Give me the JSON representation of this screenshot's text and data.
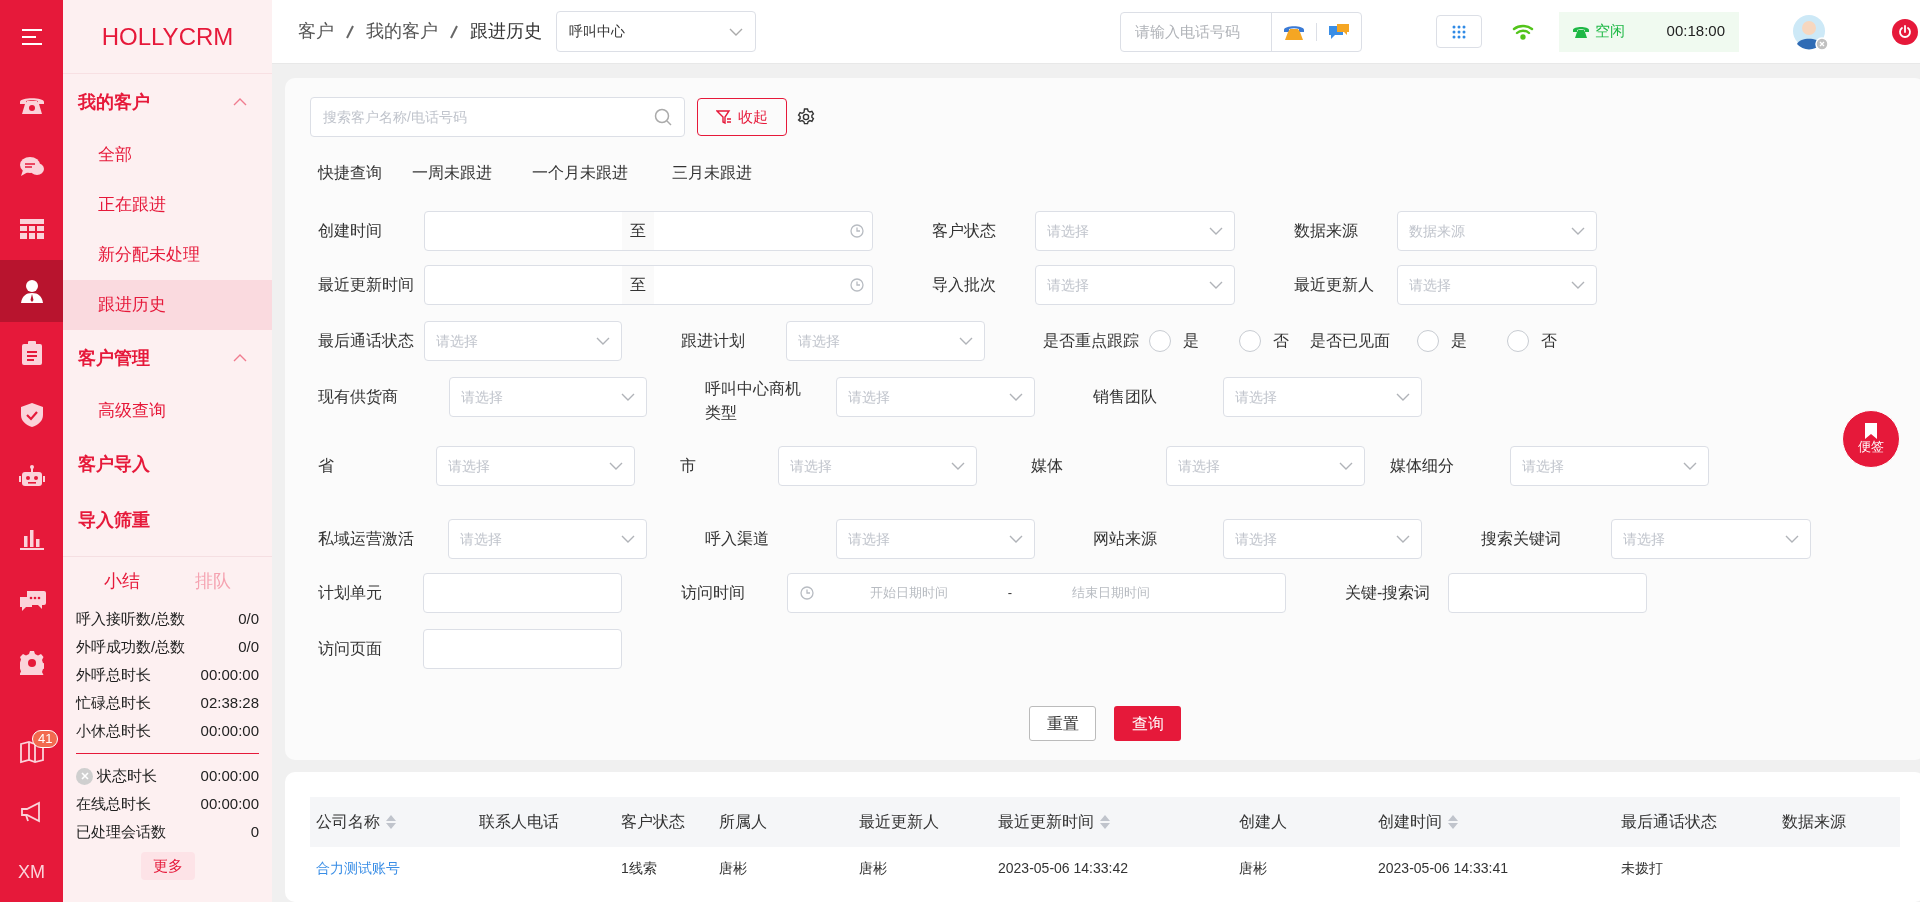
{
  "rail": {
    "items": [
      {
        "kind": "phone",
        "selected": false
      },
      {
        "kind": "chat",
        "selected": false
      },
      {
        "kind": "grid",
        "selected": false
      },
      {
        "kind": "person",
        "selected": true
      },
      {
        "kind": "clipboard",
        "selected": false
      },
      {
        "kind": "shield",
        "selected": false
      },
      {
        "kind": "robot",
        "selected": false
      },
      {
        "kind": "chart",
        "selected": false
      },
      {
        "kind": "messages",
        "selected": false
      },
      {
        "kind": "settings",
        "selected": false
      }
    ],
    "bottom": [
      {
        "kind": "book",
        "badge": "41"
      },
      {
        "kind": "megaphone"
      },
      {
        "kind": "text",
        "label": "XM"
      }
    ]
  },
  "sidebar": {
    "brand": "HOLLYCRM",
    "groups": [
      {
        "title": "我的客户",
        "expanded": true,
        "items": [
          {
            "label": "全部",
            "selected": false
          },
          {
            "label": "正在跟进",
            "selected": false
          },
          {
            "label": "新分配未处理",
            "selected": false
          },
          {
            "label": "跟进历史",
            "selected": true
          }
        ]
      },
      {
        "title": "客户管理",
        "expanded": true,
        "items": [
          {
            "label": "高级查询",
            "selected": false
          }
        ]
      },
      {
        "title": "客户导入"
      },
      {
        "title": "导入筛重"
      }
    ]
  },
  "stats": {
    "tabs": [
      {
        "label": "小结",
        "selected": true
      },
      {
        "label": "排队",
        "selected": false
      }
    ],
    "groups": [
      [
        {
          "label": "呼入接听数/总数",
          "value": "0/0"
        },
        {
          "label": "外呼成功数/总数",
          "value": "0/0"
        },
        {
          "label": "外呼总时长",
          "value": "00:00:00"
        },
        {
          "label": "忙碌总时长",
          "value": "02:38:28"
        },
        {
          "label": "小休总时长",
          "value": "00:00:00"
        }
      ],
      [
        {
          "label": "状态时长",
          "value": "00:00:00",
          "kind": "status"
        },
        {
          "label": "在线总时长",
          "value": "00:00:00"
        },
        {
          "label": "已处理会话数",
          "value": "0"
        }
      ]
    ],
    "more": "更多"
  },
  "header": {
    "breadcrumb": [
      "客户",
      "我的客户",
      "跟进历史"
    ],
    "queue_select": "呼叫中心",
    "phone_placeholder": "请输入电话号码",
    "agent_status": "空闲",
    "timer": "00:18:00"
  },
  "filters": {
    "search_placeholder": "搜索客户名称/电话号码",
    "collapse_button": "收起",
    "quick": {
      "label": "快捷查询",
      "options": [
        "一周未跟进",
        "一个月未跟进",
        "三月未跟进"
      ]
    },
    "rows": [
      [
        {
          "label": "创建时间",
          "kind": "date_range",
          "separator": "至"
        },
        {
          "label": "客户状态",
          "kind": "select",
          "placeholder": "请选择"
        },
        {
          "label": "数据来源",
          "kind": "select",
          "placeholder": "数据来源"
        }
      ],
      [
        {
          "label": "最近更新时间",
          "kind": "date_range",
          "separator": "至"
        },
        {
          "label": "导入批次",
          "kind": "select",
          "placeholder": "请选择"
        },
        {
          "label": "最近更新人",
          "kind": "select",
          "placeholder": "请选择"
        }
      ],
      [
        {
          "label": "最后通话状态",
          "kind": "select",
          "placeholder": "请选择"
        },
        {
          "label": "跟进计划",
          "kind": "select",
          "placeholder": "请选择"
        },
        {
          "label": "是否重点跟踪",
          "kind": "radio",
          "options": [
            {
              "label": "是",
              "selected": false
            },
            {
              "label": "否",
              "selected": false
            }
          ]
        },
        {
          "label": "是否已见面",
          "kind": "radio",
          "options": [
            {
              "label": "是",
              "selected": false
            },
            {
              "label": "否",
              "selected": false
            }
          ]
        }
      ],
      [
        {
          "label": "现有供货商",
          "kind": "select",
          "placeholder": "请选择"
        },
        {
          "label": "呼叫中心商机类型",
          "kind": "select",
          "placeholder": "请选择"
        },
        {
          "label": "销售团队",
          "kind": "select",
          "placeholder": "请选择"
        }
      ],
      [
        {
          "label": "省",
          "kind": "select",
          "placeholder": "请选择"
        },
        {
          "label": "市",
          "kind": "select",
          "placeholder": "请选择"
        },
        {
          "label": "媒体",
          "kind": "select",
          "placeholder": "请选择"
        },
        {
          "label": "媒体细分",
          "kind": "select",
          "placeholder": "请选择"
        }
      ],
      [
        {
          "label": "私域运营激活",
          "kind": "select",
          "placeholder": "请选择"
        },
        {
          "label": "呼入渠道",
          "kind": "select",
          "placeholder": "请选择"
        },
        {
          "label": "网站来源",
          "kind": "select",
          "placeholder": "请选择"
        },
        {
          "label": "搜索关键词",
          "kind": "select",
          "placeholder": "请选择"
        }
      ],
      [
        {
          "label": "计划单元",
          "kind": "input"
        },
        {
          "label": "访问时间",
          "kind": "datetime_range",
          "start_placeholder": "开始日期时间",
          "separator": "-",
          "end_placeholder": "结束日期时间"
        },
        {
          "label": "关键-搜索词",
          "kind": "input"
        }
      ],
      [
        {
          "label": "访问页面",
          "kind": "input"
        }
      ]
    ],
    "buttons": {
      "reset": "重置",
      "search": "查询"
    }
  },
  "float_note": "便签",
  "table": {
    "columns": [
      {
        "label": "公司名称",
        "sortable": true
      },
      {
        "label": "联系人电话",
        "sortable": false
      },
      {
        "label": "客户状态",
        "sortable": false
      },
      {
        "label": "所属人",
        "sortable": false
      },
      {
        "label": "最近更新人",
        "sortable": false
      },
      {
        "label": "最近更新时间",
        "sortable": true
      },
      {
        "label": "创建人",
        "sortable": false
      },
      {
        "label": "创建时间",
        "sortable": true
      },
      {
        "label": "最后通话状态",
        "sortable": false
      },
      {
        "label": "数据来源",
        "sortable": false
      }
    ],
    "rows": [
      {
        "company": "合力测试账号",
        "status": "1线索",
        "owner": "唐彬",
        "updater": "唐彬",
        "updated_at": "2023-05-06 14:33:42",
        "creator": "唐彬",
        "created_at": "2023-05-06 14:33:41",
        "call_status": "未拨打"
      }
    ]
  }
}
